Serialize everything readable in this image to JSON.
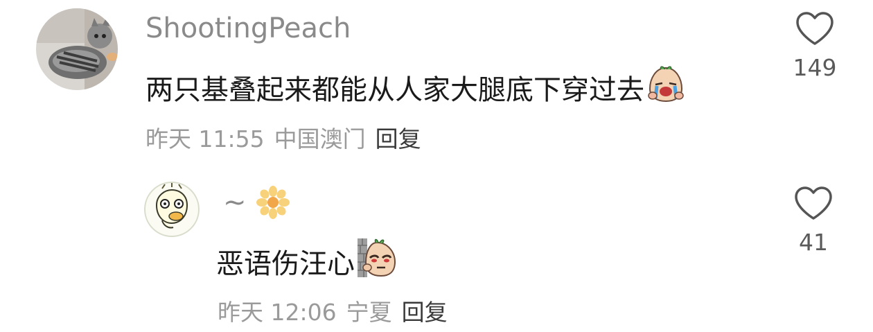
{
  "comments": [
    {
      "username": "ShootingPeach",
      "text": "两只基叠起来都能从人家大腿底下穿过去",
      "emoji": "crying-peach-emoji",
      "time": "昨天 11:55",
      "location": "中国澳门",
      "reply_label": "回复",
      "likes": "149"
    }
  ],
  "replies": [
    {
      "username": "~",
      "username_emoji": "flower-emoji",
      "text": "恶语伤汪心",
      "emoji": "peeking-peach-emoji",
      "time": "昨天 12:06",
      "location": "宁夏",
      "reply_label": "回复",
      "likes": "41"
    }
  ],
  "icons": {
    "like": "heart-outline-icon"
  },
  "colors": {
    "username": "#8a8a8a",
    "meta": "#9a9a9a",
    "text": "#1a1a1a"
  }
}
